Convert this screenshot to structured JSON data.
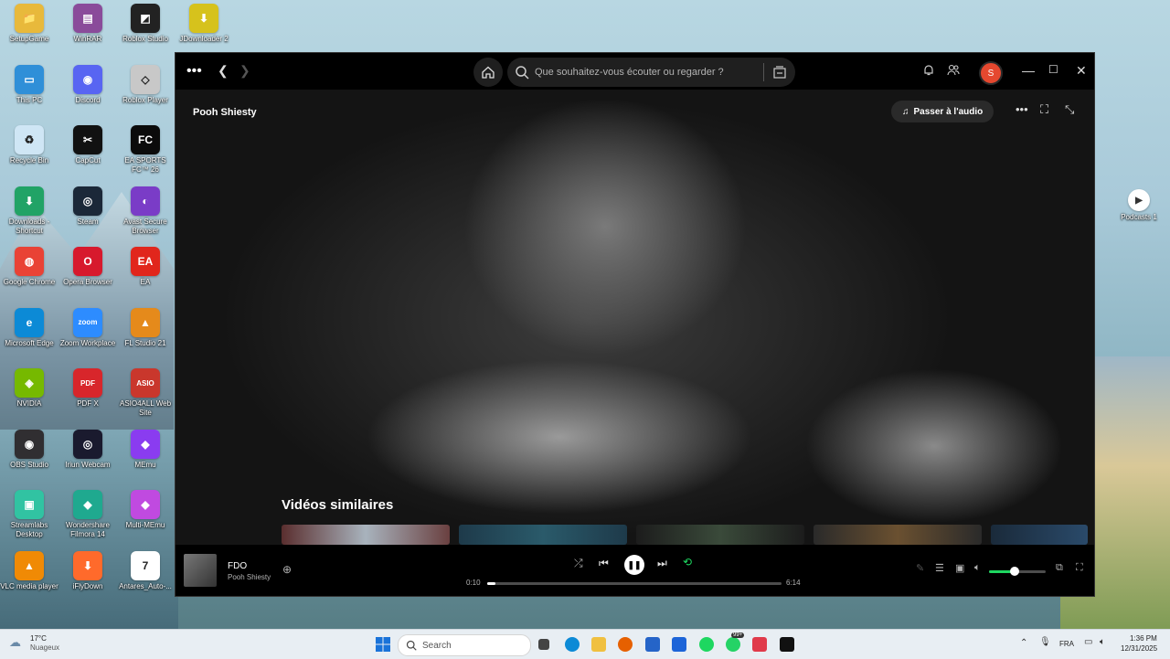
{
  "desktop": {
    "icons": [
      {
        "label": "SetupGame",
        "color": "#e8b93b",
        "glyph": "📁"
      },
      {
        "label": "WinRAR",
        "color": "#8a4b9a",
        "glyph": "▤"
      },
      {
        "label": "Roblox Studio",
        "color": "#222222",
        "glyph": "◩"
      },
      {
        "label": "JDownloader 2",
        "color": "#d6c21c",
        "glyph": "⬇"
      },
      {
        "label": "This PC",
        "color": "#2f8fd8",
        "glyph": "▭"
      },
      {
        "label": "Discord",
        "color": "#5865f2",
        "glyph": "◉"
      },
      {
        "label": "Roblox Player",
        "color": "#c8c8c8",
        "glyph": "◇"
      },
      {
        "label": "Recycle Bin",
        "color": "#cfe6f5",
        "glyph": "♻"
      },
      {
        "label": "CapCut",
        "color": "#111111",
        "glyph": "✂"
      },
      {
        "label": "EA SPORTS FC™ 26",
        "color": "#0b0b0b",
        "glyph": "FC"
      },
      {
        "label": "Downloads - Shortcut",
        "color": "#21a366",
        "glyph": "⬇"
      },
      {
        "label": "Steam",
        "color": "#1b2838",
        "glyph": "◎"
      },
      {
        "label": "Avast Secure Browser",
        "color": "#7a3cc7",
        "glyph": "◐"
      },
      {
        "label": "Google Chrome",
        "color": "#e94235",
        "glyph": "◍"
      },
      {
        "label": "Opera Browser",
        "color": "#d7192d",
        "glyph": "O"
      },
      {
        "label": "EA",
        "color": "#e1261c",
        "glyph": "EA"
      },
      {
        "label": "Microsoft Edge",
        "color": "#0c8ad6",
        "glyph": "e"
      },
      {
        "label": "Zoom Workplace",
        "color": "#2d8cff",
        "glyph": "zoom"
      },
      {
        "label": "FL Studio 21",
        "color": "#e58a1b",
        "glyph": "▲"
      },
      {
        "label": "NVIDIA",
        "color": "#76b900",
        "glyph": "◈"
      },
      {
        "label": "PDF X",
        "color": "#d8262b",
        "glyph": "PDF"
      },
      {
        "label": "ASIO4ALL Web Site",
        "color": "#c9372c",
        "glyph": "ASIO"
      },
      {
        "label": "OBS Studio",
        "color": "#302e31",
        "glyph": "◉"
      },
      {
        "label": "Iriun Webcam",
        "color": "#1a1a2e",
        "glyph": "◎"
      },
      {
        "label": "MEmu",
        "color": "#8a3cf0",
        "glyph": "◆"
      },
      {
        "label": "Streamlabs Desktop",
        "color": "#31c3a2",
        "glyph": "▣"
      },
      {
        "label": "Wondershare Filmora 14",
        "color": "#1fa98f",
        "glyph": "◆"
      },
      {
        "label": "Multi-MEmu",
        "color": "#c04ae0",
        "glyph": "◆"
      },
      {
        "label": "VLC media player",
        "color": "#f08a05",
        "glyph": "▲"
      },
      {
        "label": "iFlyDown",
        "color": "#ff6a2b",
        "glyph": "⬇"
      },
      {
        "label": "Antares_Auto-...",
        "color": "#ffffff",
        "glyph": "7"
      }
    ],
    "right_icon": {
      "label": "Podcasts 1",
      "glyph": "▶"
    }
  },
  "spotify": {
    "search_placeholder": "Que souhaitez-vous écouter ou regarder ?",
    "avatar_letter": "S",
    "artist": "Pooh Shiesty",
    "passer_audio": "Passer à l'audio",
    "similar_videos": "Vidéos similaires",
    "track": {
      "title": "FDO",
      "artist": "Pooh Shiesty",
      "elapsed": "0:10",
      "duration": "6:14",
      "progress": 0.027
    },
    "volume": 0.45
  },
  "taskbar": {
    "weather_temp": "17°C",
    "weather_desc": "Nuageux",
    "search_label": "Search",
    "badge": "99+",
    "lang": "FRA",
    "time": "1:36 PM",
    "date": "12/31/2025"
  },
  "colors": {
    "accent": "#1ed760",
    "avatar": "#e5482f"
  }
}
